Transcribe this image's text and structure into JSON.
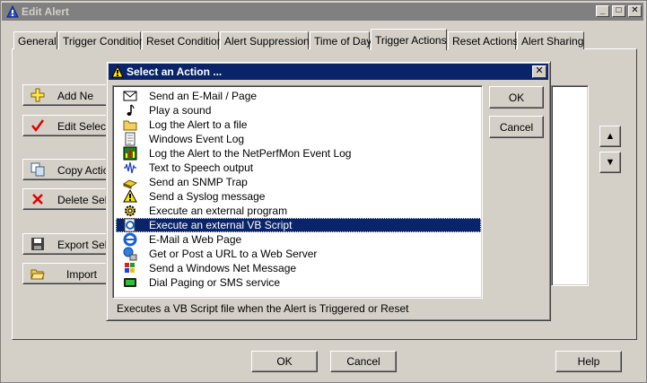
{
  "main_window": {
    "title": "Edit Alert",
    "controls": {
      "minimize": "_",
      "maximize": "□",
      "close": "✕"
    }
  },
  "tabs": [
    {
      "label": "General"
    },
    {
      "label": "Trigger Condition"
    },
    {
      "label": "Reset Condition"
    },
    {
      "label": "Alert Suppression"
    },
    {
      "label": "Time of Day"
    },
    {
      "label": "Trigger Actions",
      "active": true
    },
    {
      "label": "Reset Actions"
    },
    {
      "label": "Alert Sharing"
    }
  ],
  "left_buttons": [
    {
      "label": "Add Ne",
      "icon": "plus-icon"
    },
    {
      "label": "Edit Selec",
      "icon": "checkmark-icon"
    },
    {
      "label": "Copy Action",
      "icon": "copy-icon"
    },
    {
      "label": "Delete Selec",
      "icon": "delete-icon"
    },
    {
      "label": "Export Sele",
      "icon": "save-icon"
    },
    {
      "label": "Import",
      "icon": "open-folder-icon"
    }
  ],
  "reorder": {
    "up": "▲",
    "down": "▼"
  },
  "footer": {
    "ok_label": "OK",
    "cancel_label": "Cancel",
    "help_label": "Help"
  },
  "dialog": {
    "title": "Select an Action ...",
    "ok_label": "OK",
    "cancel_label": "Cancel",
    "description": "Executes a VB Script file when the Alert is Triggered or Reset",
    "items": [
      {
        "label": "Send an E-Mail / Page",
        "icon": "envelope-icon"
      },
      {
        "label": "Play a sound",
        "icon": "music-note-icon"
      },
      {
        "label": "Log the Alert to a file",
        "icon": "folder-icon"
      },
      {
        "label": "Windows Event Log",
        "icon": "event-log-icon"
      },
      {
        "label": "Log the Alert to the NetPerfMon Event Log",
        "icon": "netperfmon-log-icon"
      },
      {
        "label": "Text to Speech output",
        "icon": "soundwave-icon"
      },
      {
        "label": "Send an SNMP Trap",
        "icon": "snmp-trap-icon"
      },
      {
        "label": "Send a Syslog message",
        "icon": "warning-triangle-icon"
      },
      {
        "label": "Execute an external program",
        "icon": "gear-icon"
      },
      {
        "label": "Execute an external VB Script",
        "icon": "script-icon",
        "selected": true
      },
      {
        "label": "E-Mail a Web Page",
        "icon": "ie-icon"
      },
      {
        "label": "Get or Post a URL to a Web Server",
        "icon": "web-server-icon"
      },
      {
        "label": "Send a Windows Net Message",
        "icon": "windows-flag-icon"
      },
      {
        "label": "Dial Paging or SMS service",
        "icon": "pager-icon"
      }
    ]
  }
}
